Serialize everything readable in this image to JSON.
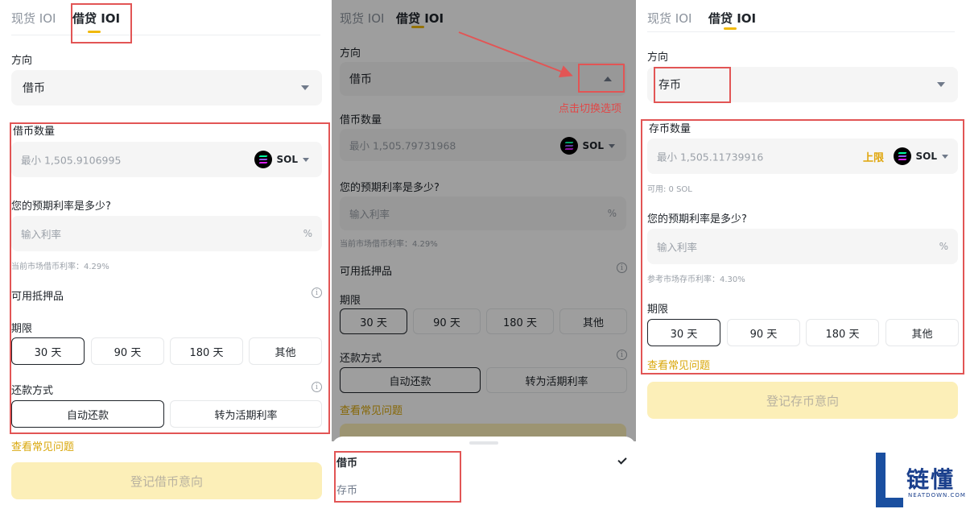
{
  "tabs": {
    "spot": "现货 IOI",
    "loan": "借贷 IOI"
  },
  "left": {
    "direction_label": "方向",
    "direction_value": "借币",
    "amount_label": "借币数量",
    "amount_placeholder": "最小 1,505.9106995",
    "coin": "SOL",
    "rate_question": "您的预期利率是多少?",
    "rate_placeholder": "输入利率",
    "rate_unit": "%",
    "market_rate": "当前市场借币利率：4.29%",
    "collateral_label": "可用抵押品",
    "term_label": "期限",
    "terms": [
      "30 天",
      "90 天",
      "180 天",
      "其他"
    ],
    "repay_label": "还款方式",
    "repay_options": [
      "自动还款",
      "转为活期利率"
    ],
    "faq_link": "查看常见问题",
    "submit": "登记借币意向"
  },
  "middle": {
    "direction_label": "方向",
    "direction_value": "借币",
    "annotation": "点击切换选项",
    "amount_label": "借币数量",
    "amount_placeholder": "最小 1,505.79731968",
    "coin": "SOL",
    "rate_question": "您的预期利率是多少?",
    "rate_placeholder": "输入利率",
    "rate_unit": "%",
    "market_rate": "当前市场借币利率：4.29%",
    "collateral_label": "可用抵押品",
    "term_label": "期限",
    "terms": [
      "30 天",
      "90 天",
      "180 天",
      "其他"
    ],
    "repay_label": "还款方式",
    "repay_options": [
      "自动还款",
      "转为活期利率"
    ],
    "faq_link": "查看常见问题",
    "sheet_options": [
      "借币",
      "存币"
    ]
  },
  "right": {
    "direction_label": "方向",
    "direction_value": "存币",
    "amount_label": "存币数量",
    "amount_placeholder": "最小 1,505.11739916",
    "max_label": "上限",
    "coin": "SOL",
    "available": "可用: 0 SOL",
    "rate_question": "您的预期利率是多少?",
    "rate_placeholder": "输入利率",
    "rate_unit": "%",
    "market_rate": "参考市场存币利率：4.30%",
    "term_label": "期限",
    "terms": [
      "30 天",
      "90 天",
      "180 天",
      "其他"
    ],
    "faq_link": "查看常见问题",
    "submit": "登记存币意向"
  },
  "watermark": {
    "cn": "链懂",
    "en": "NEATDOWN.COM"
  },
  "colors": {
    "accent": "#f0b90b",
    "annotation_red": "#e25555",
    "submit_disabled": "#fcefb8"
  }
}
